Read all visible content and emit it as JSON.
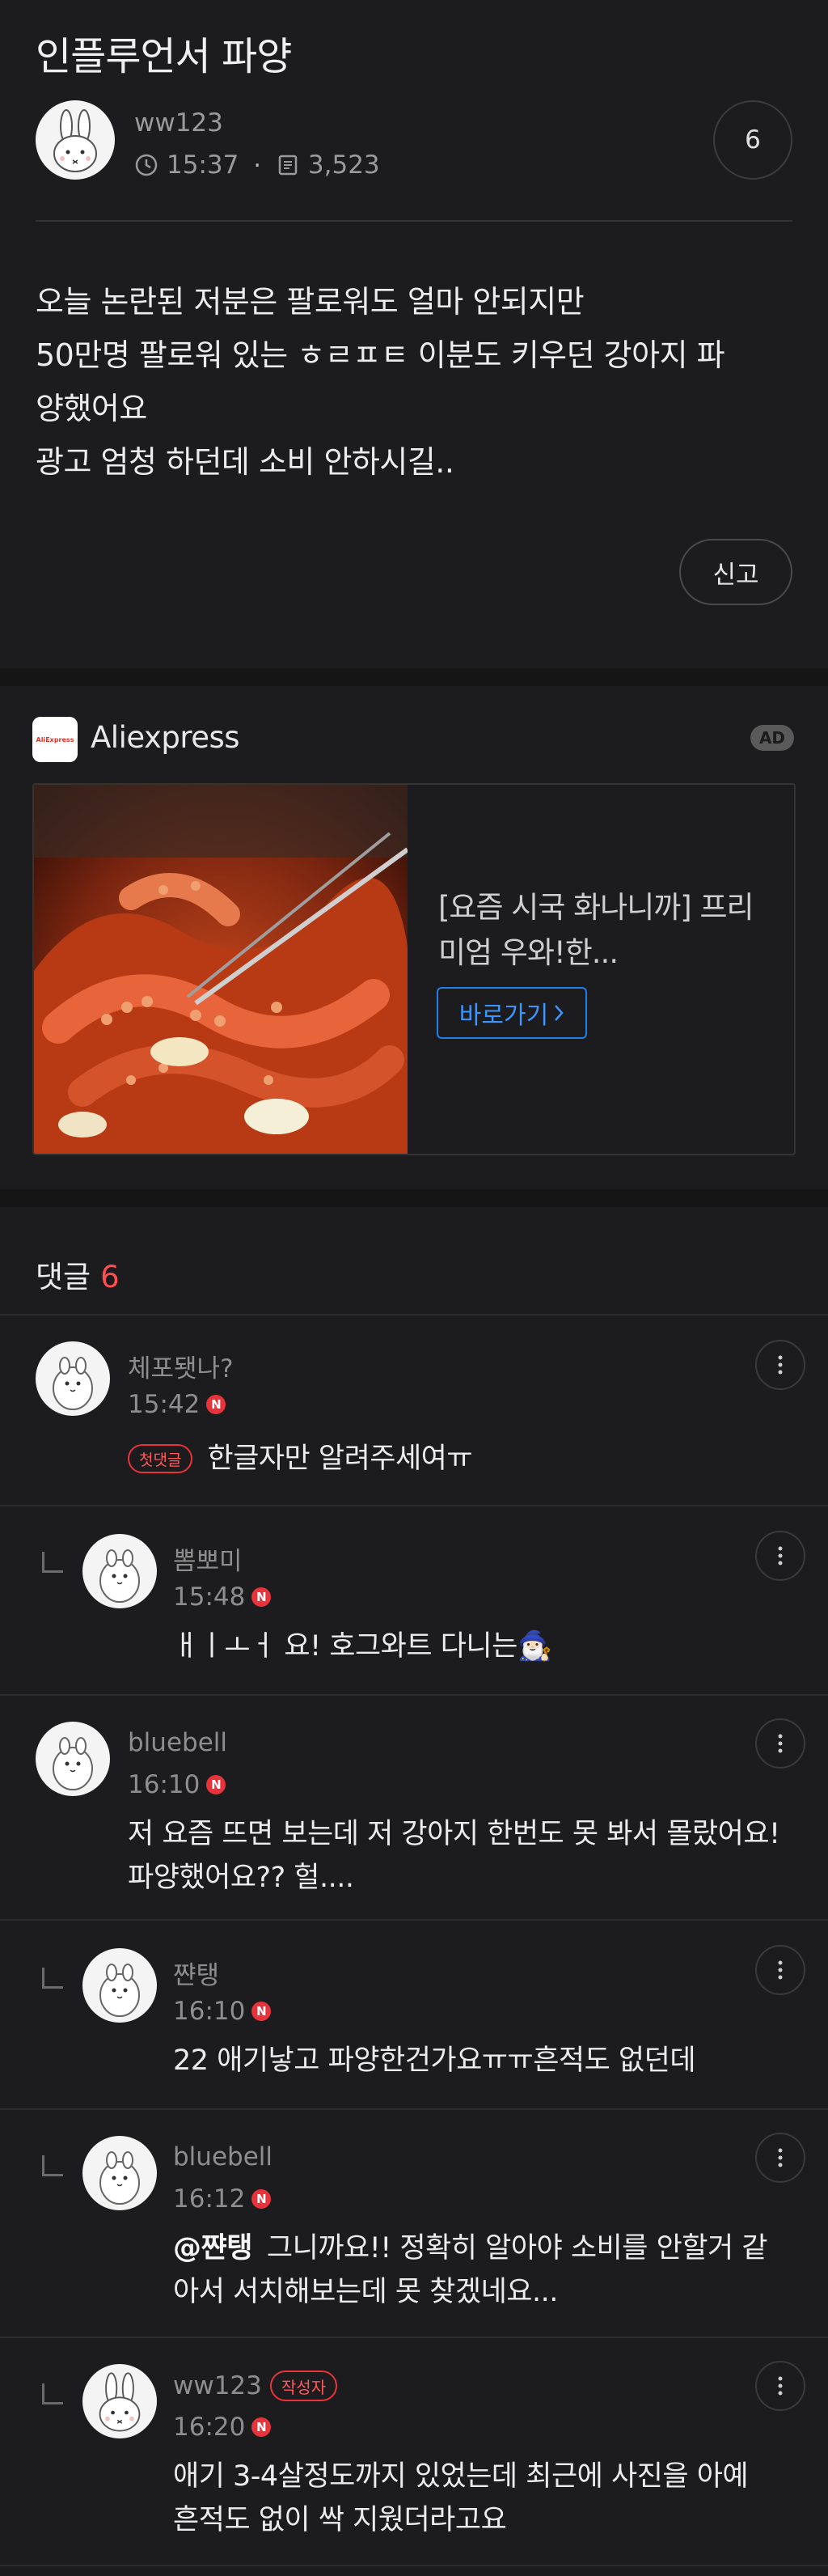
{
  "post": {
    "title": "인플루언서 파양",
    "author": "ww123",
    "time": "15:37",
    "views": "3,523",
    "comment_count": "6",
    "body_lines": [
      "오늘 논란된 저분은 팔로워도 얼마 안되지만",
      "50만명 팔로워 있는 ㅎㄹㅍㅌ 이분도 키우던 강아지 파",
      "양했어요",
      "광고 엄청 하던데 소비 안하시길.."
    ],
    "report_label": "신고"
  },
  "ad": {
    "brand": "Aliexpress",
    "logo_text": "AliExpress",
    "badge": "AD",
    "text": "[요즘 시국 화나니까] 프리미엄 우와!한...",
    "cta_label": "바로가기",
    "cta_icon": "chevron-right-icon"
  },
  "comments_section": {
    "heading": "댓글",
    "count": "6"
  },
  "comments": [
    {
      "name": "체포됏나?",
      "time": "15:42",
      "new_badge": "N",
      "tag": "첫댓글",
      "text_lines": [
        "한글자만 알려주세여ㅠ"
      ],
      "is_reply": false
    },
    {
      "name": "뽐뽀미",
      "time": "15:48",
      "new_badge": "N",
      "text_lines": [
        "ㅐㅣㅗㅓ 요! 호그와트 다니는🧙🏻‍♂️"
      ],
      "is_reply": true
    },
    {
      "name": "bluebell",
      "time": "16:10",
      "new_badge": "N",
      "text_lines": [
        "저 요즘 뜨면 보는데 저 강아지 한번도 못 봐서 몰랐어요!",
        "파양했어요?? 헐...."
      ],
      "is_reply": false
    },
    {
      "name": "쨘탱",
      "time": "16:10",
      "new_badge": "N",
      "text_lines": [
        "22 애기낳고 파양한건가요ㅠㅠ흔적도 없던데"
      ],
      "is_reply": true
    },
    {
      "name": "bluebell",
      "time": "16:12",
      "new_badge": "N",
      "mention": "@쨘탱",
      "text_lines": [
        "그니까요!! 정확히 알아야 소비를 안할거 같",
        "아서 서치해보는데 못 찾겠네요..."
      ],
      "is_reply": true
    },
    {
      "name": "ww123",
      "time": "16:20",
      "new_badge": "N",
      "author_tag": "작성자",
      "text_lines": [
        "애기 3-4살정도까지 있었는데 최근에 사진을 아예",
        "흔적도 없이 싹 지웠더라고요"
      ],
      "is_reply": true
    }
  ]
}
